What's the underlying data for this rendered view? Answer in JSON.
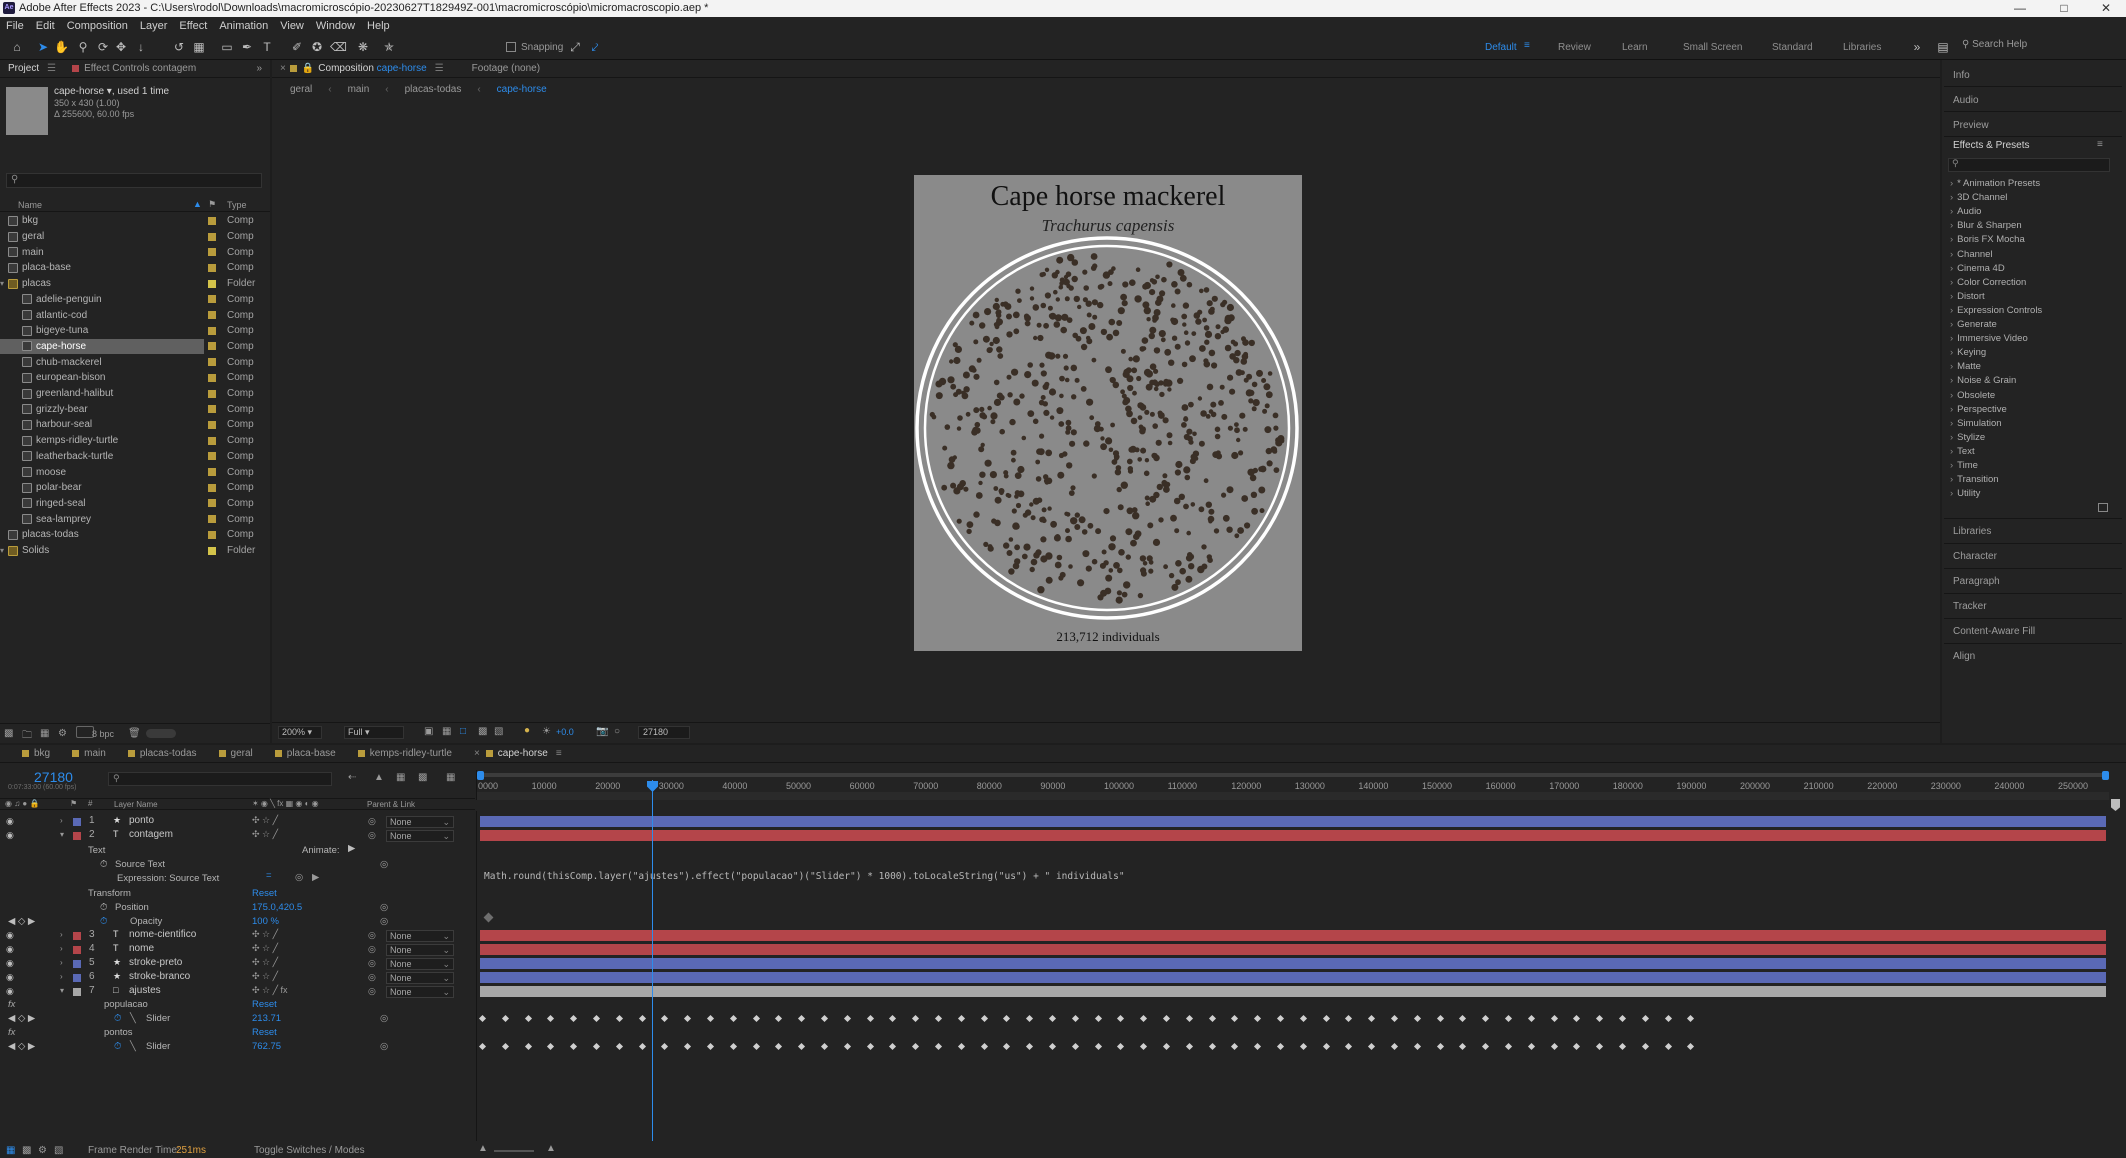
{
  "window": {
    "title": "Adobe After Effects 2023 - C:\\Users\\rodol\\Downloads\\macromicroscópio-20230627T182949Z-001\\macromicroscópio\\micromacroscopio.aep *",
    "logo_text": "Ae"
  },
  "menu": [
    "File",
    "Edit",
    "Composition",
    "Layer",
    "Effect",
    "Animation",
    "View",
    "Window",
    "Help"
  ],
  "toolbar": {
    "snapping_label": "Snapping",
    "workspaces": [
      "Default",
      "Review",
      "Learn",
      "Small Screen",
      "Standard",
      "Libraries"
    ],
    "active_workspace": "Default",
    "search_placeholder": "Search Help"
  },
  "project_panel": {
    "tab_label": "Project",
    "effect_controls_tab": "Effect Controls contagem",
    "thumb": {
      "name": "cape-horse",
      "used": ", used 1 time",
      "dims": "350 x 430 (1.00)",
      "duration": "Δ 255600, 60.00 fps"
    },
    "col_name": "Name",
    "col_type": "Type",
    "items": [
      {
        "name": "bkg",
        "type": "Comp",
        "indent": 0,
        "folder": false,
        "color": "#b99c3c"
      },
      {
        "name": "geral",
        "type": "Comp",
        "indent": 0,
        "folder": false,
        "color": "#b99c3c"
      },
      {
        "name": "main",
        "type": "Comp",
        "indent": 0,
        "folder": false,
        "color": "#b99c3c"
      },
      {
        "name": "placa-base",
        "type": "Comp",
        "indent": 0,
        "folder": false,
        "color": "#b99c3c"
      },
      {
        "name": "placas",
        "type": "Folder",
        "indent": 0,
        "folder": true,
        "color": "#d3c34a"
      },
      {
        "name": "adelie-penguin",
        "type": "Comp",
        "indent": 1,
        "folder": false,
        "color": "#b99c3c"
      },
      {
        "name": "atlantic-cod",
        "type": "Comp",
        "indent": 1,
        "folder": false,
        "color": "#b99c3c"
      },
      {
        "name": "bigeye-tuna",
        "type": "Comp",
        "indent": 1,
        "folder": false,
        "color": "#b99c3c"
      },
      {
        "name": "cape-horse",
        "type": "Comp",
        "indent": 1,
        "folder": false,
        "color": "#b99c3c",
        "selected": true
      },
      {
        "name": "chub-mackerel",
        "type": "Comp",
        "indent": 1,
        "folder": false,
        "color": "#b99c3c"
      },
      {
        "name": "european-bison",
        "type": "Comp",
        "indent": 1,
        "folder": false,
        "color": "#b99c3c"
      },
      {
        "name": "greenland-halibut",
        "type": "Comp",
        "indent": 1,
        "folder": false,
        "color": "#b99c3c"
      },
      {
        "name": "grizzly-bear",
        "type": "Comp",
        "indent": 1,
        "folder": false,
        "color": "#b99c3c"
      },
      {
        "name": "harbour-seal",
        "type": "Comp",
        "indent": 1,
        "folder": false,
        "color": "#b99c3c"
      },
      {
        "name": "kemps-ridley-turtle",
        "type": "Comp",
        "indent": 1,
        "folder": false,
        "color": "#b99c3c"
      },
      {
        "name": "leatherback-turtle",
        "type": "Comp",
        "indent": 1,
        "folder": false,
        "color": "#b99c3c"
      },
      {
        "name": "moose",
        "type": "Comp",
        "indent": 1,
        "folder": false,
        "color": "#b99c3c"
      },
      {
        "name": "polar-bear",
        "type": "Comp",
        "indent": 1,
        "folder": false,
        "color": "#b99c3c"
      },
      {
        "name": "ringed-seal",
        "type": "Comp",
        "indent": 1,
        "folder": false,
        "color": "#b99c3c"
      },
      {
        "name": "sea-lamprey",
        "type": "Comp",
        "indent": 1,
        "folder": false,
        "color": "#b99c3c"
      },
      {
        "name": "placas-todas",
        "type": "Comp",
        "indent": 0,
        "folder": false,
        "color": "#b99c3c"
      },
      {
        "name": "Solids",
        "type": "Folder",
        "indent": 0,
        "folder": true,
        "color": "#d3c34a"
      }
    ],
    "bpc": "8 bpc"
  },
  "viewer": {
    "comp_tab": "Composition",
    "comp_name": "cape-horse",
    "footage_tab": "Footage (none)",
    "breadcrumbs": [
      "geral",
      "main",
      "placas-todas",
      "cape-horse"
    ],
    "title": "Cape horse mackerel",
    "subtitle": "Trachurus capensis",
    "count": "213,712 individuals",
    "zoom": "200%",
    "resolution": "Full",
    "exposure": "+0.0",
    "timecode": "27180"
  },
  "right_panels": {
    "top": [
      "Info",
      "Audio",
      "Preview"
    ],
    "effects_title": "Effects & Presets",
    "effects": [
      "* Animation Presets",
      "3D Channel",
      "Audio",
      "Blur & Sharpen",
      "Boris FX Mocha",
      "Channel",
      "Cinema 4D",
      "Color Correction",
      "Distort",
      "Expression Controls",
      "Generate",
      "Immersive Video",
      "Keying",
      "Matte",
      "Noise & Grain",
      "Obsolete",
      "Perspective",
      "Simulation",
      "Stylize",
      "Text",
      "Time",
      "Transition",
      "Utility"
    ],
    "bottom": [
      "Libraries",
      "Character",
      "Paragraph",
      "Tracker",
      "Content-Aware Fill",
      "Align"
    ]
  },
  "timeline": {
    "tabs": [
      "bkg",
      "main",
      "placas-todas",
      "geral",
      "placa-base",
      "kemps-ridley-turtle",
      "cape-horse"
    ],
    "active_tab": "cape-horse",
    "timecode": "27180",
    "timecode_sub": "0:07:33:00 (60.00 fps)",
    "col_layer_name": "Layer Name",
    "col_parent": "Parent & Link",
    "ruler": [
      "0000",
      "10000",
      "20000",
      "30000",
      "40000",
      "50000",
      "60000",
      "70000",
      "80000",
      "90000",
      "100000",
      "110000",
      "120000",
      "130000",
      "140000",
      "150000",
      "160000",
      "170000",
      "180000",
      "190000",
      "200000",
      "210000",
      "220000",
      "230000",
      "240000",
      "250000"
    ],
    "animate_label": "Animate:",
    "expression": "Math.round(thisComp.layer(\"ajustes\").effect(\"populacao\")(\"Slider\") * 1000).toLocaleString(\"us\") + \" individuals\"",
    "layers_top": [
      {
        "num": "1",
        "name": "ponto",
        "type": "star",
        "color": "#5a69b5",
        "parent": "None"
      },
      {
        "num": "2",
        "name": "contagem",
        "type": "T",
        "color": "#b4454a",
        "parent": "None"
      }
    ],
    "props": {
      "text": "Text",
      "source_text": "Source Text",
      "expr_label": "Expression: Source Text",
      "transform": "Transform",
      "reset": "Reset",
      "position": "Position",
      "position_val": "175.0,420.5",
      "opacity": "Opacity",
      "opacity_val": "100",
      "opacity_unit": "%"
    },
    "layers_bottom": [
      {
        "num": "3",
        "name": "nome-cientifico",
        "type": "T",
        "color": "#b4454a",
        "parent": "None"
      },
      {
        "num": "4",
        "name": "nome",
        "type": "T",
        "color": "#b4454a",
        "parent": "None"
      },
      {
        "num": "5",
        "name": "stroke-preto",
        "type": "star",
        "color": "#5a69b5",
        "parent": "None"
      },
      {
        "num": "6",
        "name": "stroke-branco",
        "type": "star",
        "color": "#5a69b5",
        "parent": "None"
      },
      {
        "num": "7",
        "name": "ajustes",
        "type": "null",
        "color": "#a7a7a7",
        "parent": "None"
      }
    ],
    "effects": [
      {
        "name": "populacao",
        "reset": "Reset",
        "slider": "Slider",
        "value": "213.71"
      },
      {
        "name": "pontos",
        "reset": "Reset",
        "slider": "Slider",
        "value": "762.75"
      }
    ]
  },
  "status": {
    "frame_render_label": "Frame Render Time:",
    "frame_render_value": "251ms",
    "toggle": "Toggle Switches / Modes"
  },
  "colors": {
    "accent": "#2d8ceb",
    "layer_blue": "#5a69b5",
    "layer_red": "#b4454a",
    "layer_gray": "#a7a7a7"
  }
}
